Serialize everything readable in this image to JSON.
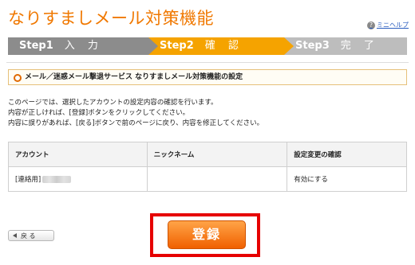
{
  "header": {
    "title": "なりすましメール対策機能",
    "help_label": "ミニヘルプ",
    "help_icon": "?"
  },
  "steps": [
    {
      "num": "Step1",
      "label": "入 力"
    },
    {
      "num": "Step2",
      "label": "確 認"
    },
    {
      "num": "Step3",
      "label": "完 了"
    }
  ],
  "section": {
    "heading": "メール／迷惑メール撃退サービス なりすましメール対策機能の設定"
  },
  "description": [
    "このページでは、選択したアカウントの設定内容の確認を行います。",
    "内容が正しければ、[登録]ボタンをクリックしてください。",
    "内容に誤りがあれば、[戻る]ボタンで前のページに戻り、内容を修正してください。"
  ],
  "table": {
    "headers": [
      "アカウント",
      "ニックネーム",
      "設定変更の確認"
    ],
    "rows": [
      {
        "account": "[連絡用]",
        "nickname": "",
        "change": "有効にする"
      }
    ]
  },
  "buttons": {
    "back": "戻 る",
    "register": "登録"
  }
}
